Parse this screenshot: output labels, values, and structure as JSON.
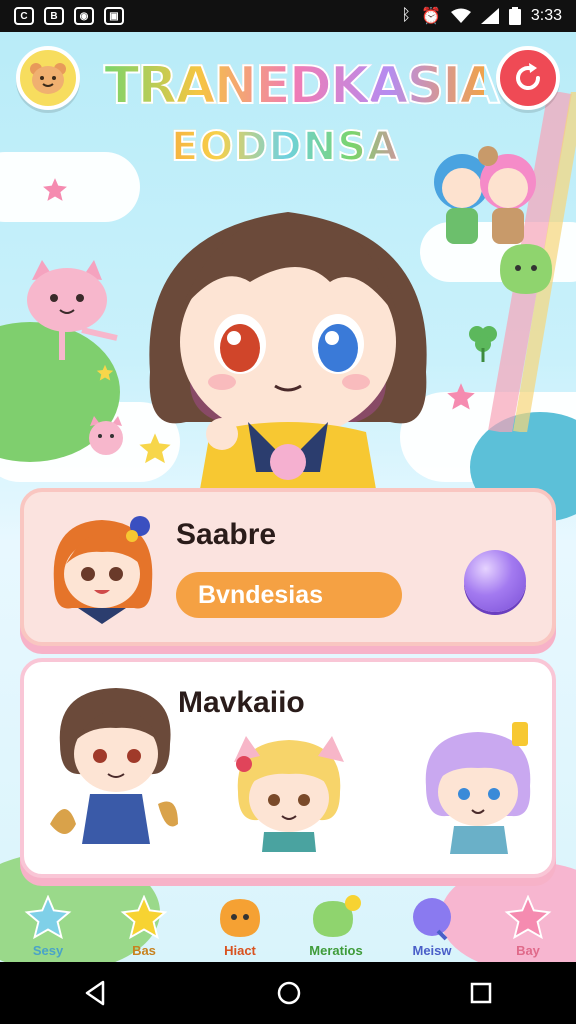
{
  "status_bar": {
    "time": "3:33",
    "left_icons": [
      "notification-icon-1",
      "notification-icon-2",
      "notification-icon-3",
      "notification-icon-4"
    ],
    "right_icons": [
      "bluetooth-icon",
      "alarm-icon",
      "wifi-icon",
      "signal-icon",
      "battery-icon"
    ]
  },
  "header": {
    "title_line1": "TRANEDKASIA",
    "title_line2": "EODDNSA",
    "left_button_icon": "bear-face-icon",
    "right_button_icon": "refresh-icon"
  },
  "panel1": {
    "name": "Saabre",
    "pill_label": "Bvndesias",
    "action_icon": "purple-orb-icon"
  },
  "panel2": {
    "name": "Mavkaiio"
  },
  "nav": {
    "items": [
      {
        "label": "Sesy",
        "color": "#4aa3c8",
        "icon": "star-blue-icon"
      },
      {
        "label": "Bas",
        "color": "#c8821f",
        "icon": "star-yellow-icon"
      },
      {
        "label": "Hiact",
        "color": "#d9521f",
        "icon": "orange-blob-icon"
      },
      {
        "label": "Meratios",
        "color": "#3f9c3a",
        "icon": "green-blob-icon"
      },
      {
        "label": "Meisw",
        "color": "#4a5fc8",
        "icon": "purple-blob-icon"
      },
      {
        "label": "Bay",
        "color": "#e06a8a",
        "icon": "star-pink-icon"
      }
    ]
  },
  "colors": {
    "accent_orange": "#f5a143",
    "accent_purple": "#a37af0",
    "panel_pink": "#fbe3df",
    "sky": "#b9ecf8"
  }
}
